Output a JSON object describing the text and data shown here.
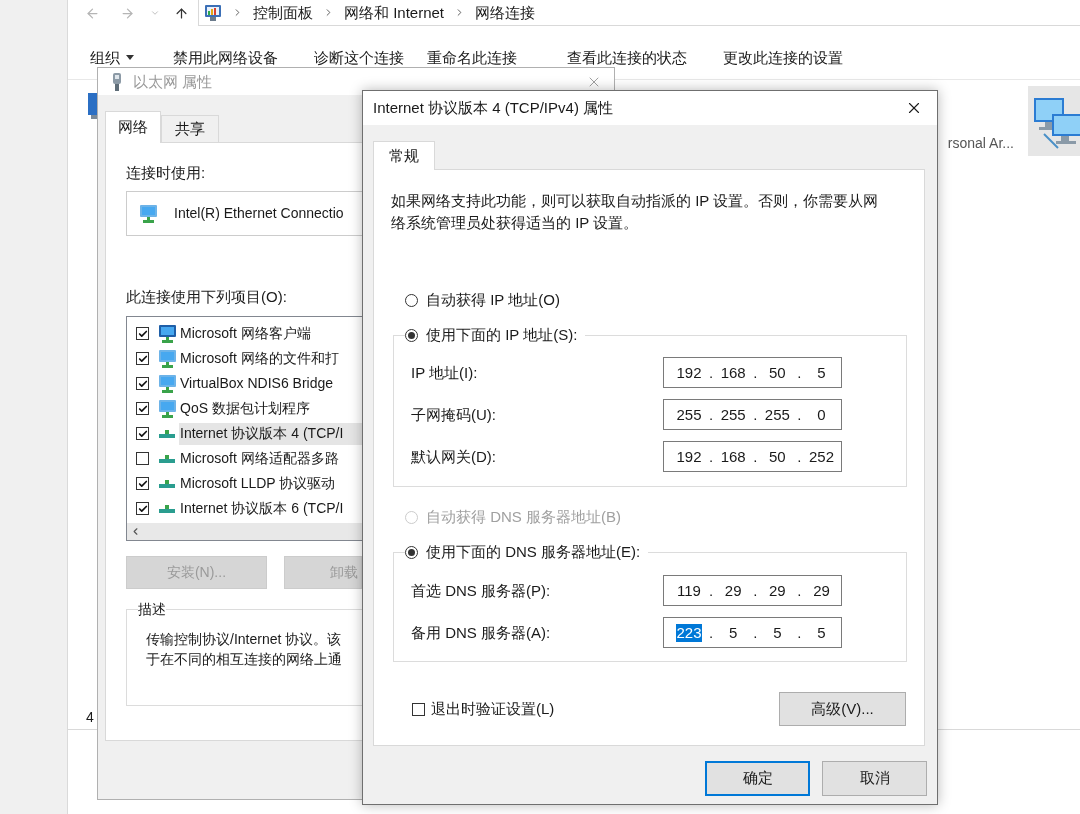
{
  "explorer": {
    "breadcrumb": [
      "控制面板",
      "网络和 Internet",
      "网络连接"
    ],
    "toolbar": [
      {
        "label": "组织",
        "kind": "menu"
      },
      {
        "label": "禁用此网络设备",
        "kind": "command"
      },
      {
        "label": "诊断这个连接",
        "kind": "command"
      },
      {
        "label": "重命名此连接",
        "kind": "command"
      },
      {
        "label": "查看此连接的状态",
        "kind": "command"
      },
      {
        "label": "更改此连接的设置",
        "kind": "command"
      }
    ],
    "item_label": "rsonal Ar...",
    "status_text": "4"
  },
  "ethernet_dialog": {
    "title": "以太网 属性",
    "active": false,
    "tabs": [
      {
        "label": "网络",
        "selected": true
      },
      {
        "label": "共享",
        "selected": false
      }
    ],
    "connect_using_label": "连接时使用:",
    "adapter": "Intel(R) Ethernet Connectio",
    "items_label": "此连接使用下列项目(O):",
    "items": [
      {
        "label": "Microsoft 网络客户端",
        "kind": "client",
        "checked": true,
        "selected": false
      },
      {
        "label": "Microsoft 网络的文件和打",
        "kind": "service",
        "checked": true,
        "selected": false
      },
      {
        "label": "VirtualBox NDIS6 Bridge",
        "kind": "service",
        "checked": true,
        "selected": false
      },
      {
        "label": "QoS 数据包计划程序",
        "kind": "service",
        "checked": true,
        "selected": false
      },
      {
        "label": "Internet 协议版本 4 (TCP/I",
        "kind": "protocol",
        "checked": true,
        "selected": true
      },
      {
        "label": "Microsoft 网络适配器多路",
        "kind": "protocol",
        "checked": false,
        "selected": false
      },
      {
        "label": "Microsoft LLDP 协议驱动",
        "kind": "protocol",
        "checked": true,
        "selected": false
      },
      {
        "label": "Internet 协议版本 6 (TCP/I",
        "kind": "protocol",
        "checked": true,
        "selected": false
      }
    ],
    "buttons": [
      {
        "label": "安装(N)...",
        "disabled": true
      },
      {
        "label": "卸载",
        "disabled": true
      }
    ],
    "description_title": "描述",
    "description_lines": [
      "传输控制协议/Internet 协议。该",
      "于在不同的相互连接的网络上通"
    ]
  },
  "ipv4_dialog": {
    "title": "Internet 协议版本 4 (TCP/IPv4) 属性",
    "active": true,
    "tabs": [
      {
        "label": "常规",
        "selected": true
      }
    ],
    "intro": "如果网络支持此功能，则可以获取自动指派的 IP 设置。否则，你需要从网络系统管理员处获得适当的 IP 设置。",
    "ip_options": [
      {
        "label": "自动获得 IP 地址(O)",
        "selected": false,
        "disabled": false
      },
      {
        "label": "使用下面的 IP 地址(S):",
        "selected": true,
        "disabled": false
      }
    ],
    "ip_fields": [
      {
        "label": "IP 地址(I):",
        "octets": [
          {
            "text": "192",
            "selected": false
          },
          {
            "text": "168",
            "selected": false
          },
          {
            "text": "50",
            "selected": false
          },
          {
            "text": "5",
            "selected": false
          }
        ],
        "separators": [
          ".",
          ".",
          "."
        ]
      },
      {
        "label": "子网掩码(U):",
        "octets": [
          {
            "text": "255",
            "selected": false
          },
          {
            "text": "255",
            "selected": false
          },
          {
            "text": "255",
            "selected": false
          },
          {
            "text": "0",
            "selected": false
          }
        ],
        "separators": [
          ".",
          ".",
          "."
        ]
      },
      {
        "label": "默认网关(D):",
        "octets": [
          {
            "text": "192",
            "selected": false
          },
          {
            "text": "168",
            "selected": false
          },
          {
            "text": "50",
            "selected": false
          },
          {
            "text": "252",
            "selected": false
          }
        ],
        "separators": [
          ".",
          ".",
          "."
        ]
      }
    ],
    "dns_options": [
      {
        "label": "自动获得 DNS 服务器地址(B)",
        "selected": false,
        "disabled": true
      },
      {
        "label": "使用下面的 DNS 服务器地址(E):",
        "selected": true,
        "disabled": false
      }
    ],
    "dns_fields": [
      {
        "label": "首选 DNS 服务器(P):",
        "octets": [
          {
            "text": "119",
            "selected": false
          },
          {
            "text": "29",
            "selected": false
          },
          {
            "text": "29",
            "selected": false
          },
          {
            "text": "29",
            "selected": false
          }
        ],
        "separators": [
          ".",
          ".",
          "."
        ]
      },
      {
        "label": "备用 DNS 服务器(A):",
        "octets": [
          {
            "text": "223",
            "selected": true
          },
          {
            "text": "5",
            "selected": false
          },
          {
            "text": "5",
            "selected": false
          },
          {
            "text": "5",
            "selected": false
          }
        ],
        "separators": [
          ".",
          ".",
          "."
        ]
      }
    ],
    "validate_on_exit": {
      "label": "退出时验证设置(L)",
      "checked": false
    },
    "advanced_button": "高级(V)...",
    "buttons": [
      {
        "label": "确定",
        "default": true
      },
      {
        "label": "取消",
        "default": false
      }
    ]
  }
}
